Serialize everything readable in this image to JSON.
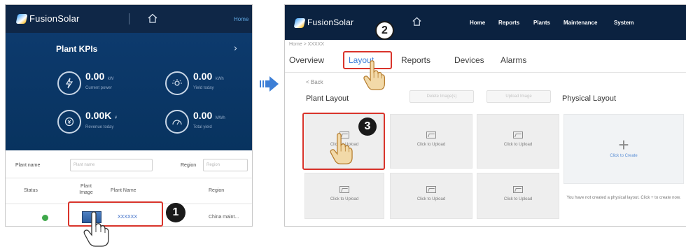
{
  "left": {
    "brand": "FusionSolar",
    "top_link": "Home",
    "kpi_title": "Plant KPIs",
    "kpis": [
      {
        "value": "0.00",
        "unit": "kW",
        "label": "Current power",
        "icon": "lightning-icon"
      },
      {
        "value": "0.00",
        "unit": "kWh",
        "label": "Yield today",
        "icon": "sun-icon"
      },
      {
        "value": "0.00K",
        "unit": "¥",
        "label": "Revenue today",
        "icon": "coin-icon"
      },
      {
        "value": "0.00",
        "unit": "MWh",
        "label": "Total yield",
        "icon": "meter-icon"
      }
    ],
    "filter": {
      "plant_name_label": "Plant name",
      "plant_name_placeholder": "Plant name",
      "region_label": "Region",
      "region_placeholder": "Region"
    },
    "table": {
      "headers": [
        "Status",
        "Plant Image",
        "Plant Name",
        "Region"
      ],
      "row": {
        "plant_name": "XXXXXX",
        "region": "China maint..."
      }
    }
  },
  "right": {
    "brand": "FusionSolar",
    "nav": [
      "Home",
      "Reports",
      "Plants",
      "Maintenance",
      "System"
    ],
    "breadcrumb": "Home > XXXXX",
    "tabs": [
      "Overview",
      "Layout",
      "Reports",
      "Devices",
      "Alarms"
    ],
    "back": "< Back",
    "plant_layout_title": "Plant Layout",
    "disabled_buttons": [
      "Delete Image(s)",
      "Upload Image"
    ],
    "physical_layout_title": "Physical Layout",
    "upload_text": "Click to Upload",
    "create_text": "Click to Create",
    "note": "You have not created a physical layout. Click + to create now."
  },
  "badges": [
    "1",
    "2",
    "3"
  ],
  "colors": {
    "dark_nav": "#0b2240",
    "kpi_blue": "#0d3a6d",
    "highlight_red": "#d9342b",
    "active_tab": "#3a7dd8",
    "arrow_blue": "#3d7fd6"
  }
}
